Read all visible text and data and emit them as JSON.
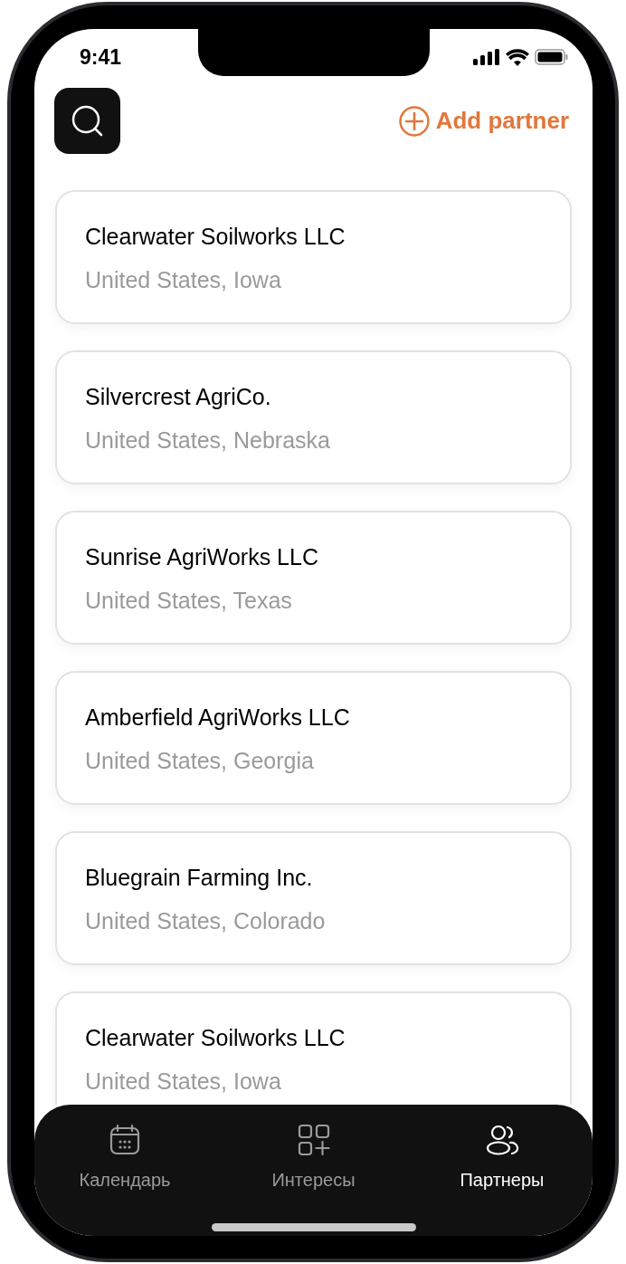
{
  "status_bar": {
    "time": "9:41"
  },
  "header": {
    "add_button": "Add partner"
  },
  "partners": [
    {
      "name": "Clearwater Soilworks LLC",
      "location": "United States, Iowa"
    },
    {
      "name": "Silvercrest AgriCo.",
      "location": "United States, Nebraska"
    },
    {
      "name": "Sunrise AgriWorks LLC",
      "location": "United States, Texas"
    },
    {
      "name": "Amberfield AgriWorks LLC",
      "location": "United States, Georgia"
    },
    {
      "name": "Bluegrain Farming Inc.",
      "location": "United States, Colorado"
    },
    {
      "name": "Clearwater Soilworks LLC",
      "location": "United States, Iowa"
    }
  ],
  "tabs": [
    {
      "kind": "calendar",
      "label": "Календарь",
      "selected": false
    },
    {
      "kind": "interests",
      "label": "Интересы",
      "selected": false
    },
    {
      "kind": "partners",
      "label": "Партнеры",
      "selected": true
    }
  ]
}
